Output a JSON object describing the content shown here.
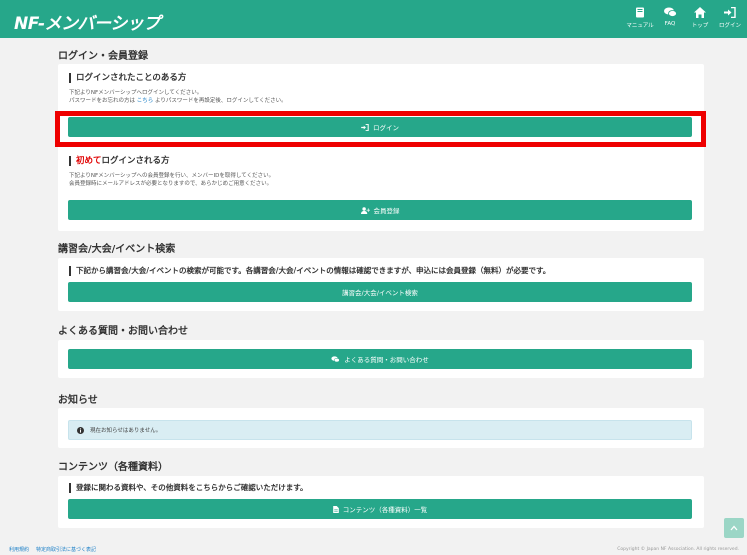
{
  "header": {
    "logo": "NF-メンバーシップ",
    "nav": [
      {
        "icon": "book-icon",
        "label": "マニュアル"
      },
      {
        "icon": "chat-icon",
        "label": "FAQ"
      },
      {
        "icon": "home-icon",
        "label": "トップ"
      },
      {
        "icon": "login-icon",
        "label": "ログイン"
      }
    ]
  },
  "login_section": {
    "title": "ログイン・会員登録",
    "existing": {
      "heading": "ログインされたことのある方",
      "desc_line1": "下記よりNFメンバーシップへログインしてください。",
      "desc_line2_pre": "パスワードをお忘れの方は ",
      "desc_line2_link": "こちら",
      "desc_line2_post": " よりパスワードを再設定後、ログインしてください。",
      "button": "ログイン"
    },
    "new": {
      "heading_red": "初めて",
      "heading_rest": "ログインされる方",
      "desc_line1": "下記よりNFメンバーシップへの会員登録を行い、メンバーIDを取得してください。",
      "desc_line2": "会員登録時にメールアドレスが必要となりますので、あらかじめご用意ください。",
      "button": "会員登録"
    }
  },
  "events_section": {
    "title": "講習会/大会/イベント検索",
    "heading": "下記から講習会/大会/イベントの検索が可能です。各講習会/大会/イベントの情報は確認できますが、申込には会員登録（無料）が必要です。",
    "button": "講習会/大会/イベント検索"
  },
  "faq_section": {
    "title": "よくある質問・お問い合わせ",
    "button": "よくある質問・お問い合わせ"
  },
  "news_section": {
    "title": "お知らせ",
    "notice": "現在お知らせはありません。"
  },
  "contents_section": {
    "title": "コンテンツ（各種資料）",
    "heading": "登録に関わる資料や、その他資料をこちらからご確認いただけます。",
    "button": "コンテンツ（各種資料）一覧"
  },
  "footer": {
    "link_terms": "利用規約",
    "link_law": "特定商取引法に基づく表記",
    "copyright": "Copyright © Japan NF Association. All rights reserved."
  },
  "colors": {
    "accent": "#26a78a",
    "highlight": "#ee0000",
    "link": "#1a7fc7"
  }
}
